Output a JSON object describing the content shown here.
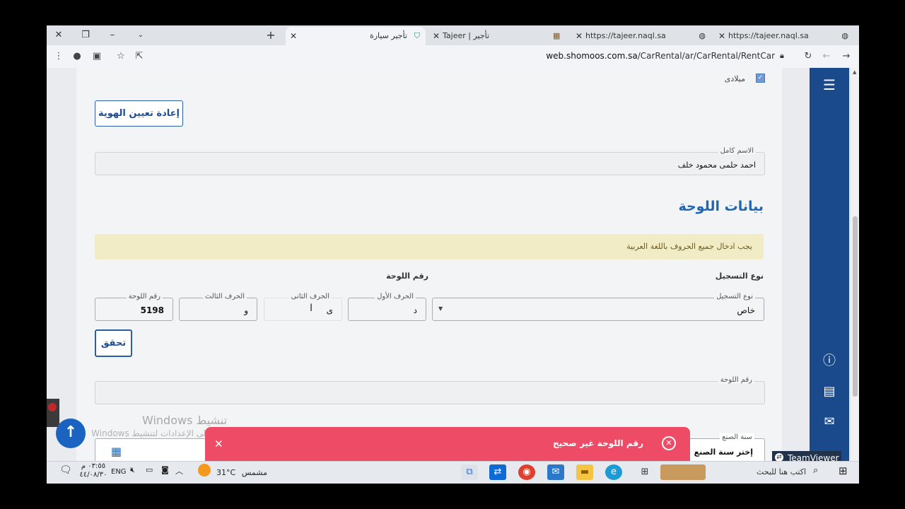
{
  "browser": {
    "tabs": [
      {
        "title": "https://tajeer.naql.sa",
        "icon": "globe-icon"
      },
      {
        "title": "https://tajeer.naql.sa",
        "icon": "globe-icon"
      },
      {
        "title": "تأجير | Tajeer",
        "icon": "naql-logo-icon"
      },
      {
        "title": "تأجير سيارة",
        "icon": "shield-icon",
        "active": true
      }
    ],
    "url_host": "web.shomoos.com.sa",
    "url_path": "/CarRental/ar/CarRental/RentCar"
  },
  "page": {
    "calendar_type_label": "ميلادى",
    "reset_identity_button": "إعادة تعيين الهوية",
    "full_name_label": "الاسم كامل",
    "full_name_value": "احمد حلمى محمود خلف",
    "section_title": "بيانات اللوحة",
    "alert_text": "يجب ادخال جميع الحروف باللغة العربية",
    "registration_type_heading": "نوع التسجيل",
    "plate_number_heading": "رقم اللوحة",
    "registration_type_label": "نوع التسجيل",
    "registration_type_value": "خاص",
    "first_letter_label": "الحرف الأول",
    "first_letter_value": "د",
    "second_letter_label": "الحرف الثانى",
    "second_letter_value": "ى",
    "third_letter_label": "الحرف الثالث",
    "third_letter_value": "و",
    "plate_number_label": "رقم اللوحة",
    "plate_number_value": "5198",
    "verify_button": "تحقق",
    "plate_number_result_label": "رقم اللوحة",
    "manufacture_year_label": "سنة الصنع",
    "manufacture_year_value": "إختر سنة الصنع"
  },
  "toast": {
    "message": "رقم اللوحة غير صحيح",
    "color": "#ee4b66"
  },
  "overlay": {
    "windows_activate": "تنشيط Windows",
    "windows_activate_sub": "انتقل إلى الإعدادات لتنشيط Windows",
    "teamviewer": "TeamViewer"
  },
  "taskbar": {
    "search_placeholder": "اكتب هنا للبحث",
    "weather_text": "مشمس",
    "temperature": "31°C",
    "language": "ENG",
    "time": "٠٣:٥٥ م",
    "date": "٤٤/٠٨/٣٠"
  },
  "colors": {
    "sidebar": "#1a4a8c",
    "accent": "#1f67b5"
  }
}
